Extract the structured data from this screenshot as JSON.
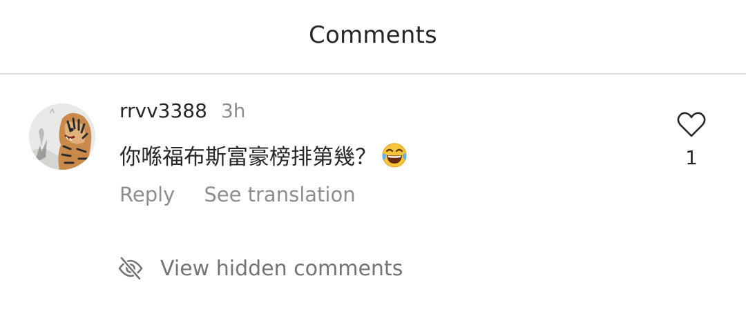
{
  "header": {
    "title": "Comments"
  },
  "comment": {
    "username": "rrvv3388",
    "time_ago": "3h",
    "text": "你喺福布斯富豪榜排第幾？",
    "emoji_icon": "face-with-tears-of-joy-icon",
    "reply_label": "Reply",
    "translate_label": "See translation",
    "like_icon": "heart-outline-icon",
    "like_count": "1",
    "avatar_icon": "tiger-painting-avatar"
  },
  "hidden_comments": {
    "icon": "eye-slash-icon",
    "label": "View hidden comments"
  },
  "colors": {
    "primary_text": "#262626",
    "secondary_text": "#8e8e8e",
    "divider": "#dbdbdb",
    "background": "#ffffff"
  }
}
